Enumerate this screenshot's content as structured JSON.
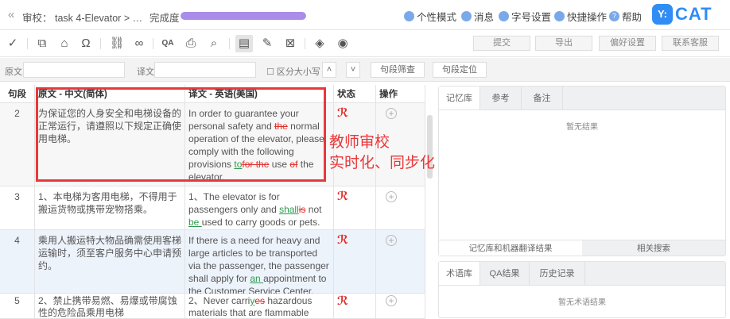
{
  "header": {
    "back_icon": "double-chevron-left",
    "title": "审校： task 4-Elevator > …",
    "progress_label": "完成度",
    "progress_percent": 100,
    "nav": [
      {
        "icon": "shirt-icon",
        "label": "个性模式"
      },
      {
        "icon": "bell-icon",
        "label": "消息"
      },
      {
        "icon": "font-icon",
        "label": "字号设置"
      },
      {
        "icon": "lightning-icon",
        "label": "快捷操作"
      },
      {
        "icon": "help-icon",
        "label": "帮助"
      }
    ],
    "logo": {
      "badge": "Y:",
      "text": "CAT"
    }
  },
  "toolbar": {
    "submit": "提交",
    "export": "导出",
    "prefs": "偏好设置",
    "support": "联系客服",
    "qa": "QA"
  },
  "search": {
    "source_label": "原文",
    "source_value": "",
    "target_label": "译文",
    "target_value": "",
    "case_label": "区分大小写",
    "filter": "句段筛查",
    "locate": "句段定位"
  },
  "table": {
    "headers": [
      "句段",
      "原文 - 中文(简体)",
      "译文 - 英语(美国)",
      "状态",
      "操作"
    ],
    "rows": [
      {
        "id": "2",
        "source": "为保证您的人身安全和电梯设备的正常运行，请遵照以下规定正确使用电梯。",
        "target": [
          [
            "n",
            "In order to guarantee your personal safety and "
          ],
          [
            "d",
            "the"
          ],
          [
            "n",
            " normal operation of the elevator, please comply with the following provisions "
          ],
          [
            "i",
            "to"
          ],
          [
            "d",
            "for the"
          ],
          [
            "n",
            " use "
          ],
          [
            "d",
            "of"
          ],
          [
            "n",
            " the elevator."
          ]
        ]
      },
      {
        "id": "3",
        "source": "1、本电梯为客用电梯，不得用于搬运货物或携带宠物搭乘。",
        "target": [
          [
            "n",
            "1、The elevator is for passengers only and "
          ],
          [
            "i",
            "shall"
          ],
          [
            "d",
            "is"
          ],
          [
            "n",
            " not "
          ],
          [
            "i",
            "be "
          ],
          [
            "n",
            "used to carry goods or pets."
          ]
        ]
      },
      {
        "id": "4",
        "source": "乘用人搬运特大物品确需使用客梯运输时，须至客户服务中心申请预约。",
        "target": [
          [
            "n",
            "If there is a need for heavy and large articles to be transported via the passenger, the passenger shall apply for "
          ],
          [
            "i",
            "an "
          ],
          [
            "n",
            "appointment to the Customer Service Center."
          ]
        ]
      },
      {
        "id": "5",
        "source": "2、禁止携带易燃、易爆或带腐蚀性的危险品乘用电梯",
        "target": [
          [
            "n",
            "2、Never carri"
          ],
          [
            "i",
            "y"
          ],
          [
            "d",
            "es"
          ],
          [
            "n",
            " hazardous materials that are flammable"
          ]
        ]
      }
    ]
  },
  "annotation": [
    "教师审校",
    "实时化、同步化"
  ],
  "right": {
    "tabs1": [
      "记忆库",
      "参考",
      "备注"
    ],
    "empty1": "暂无结果",
    "subtabs": [
      "记忆库和机器翻译结果",
      "相关搜索"
    ],
    "tabs2": [
      "术语库",
      "QA结果",
      "历史记录"
    ],
    "empty2": "暂无术语结果"
  },
  "colors": {
    "accent": "#2f8df5",
    "progress": "#a98de8",
    "delete": "#e0302c",
    "insert": "#2d9a4e"
  }
}
